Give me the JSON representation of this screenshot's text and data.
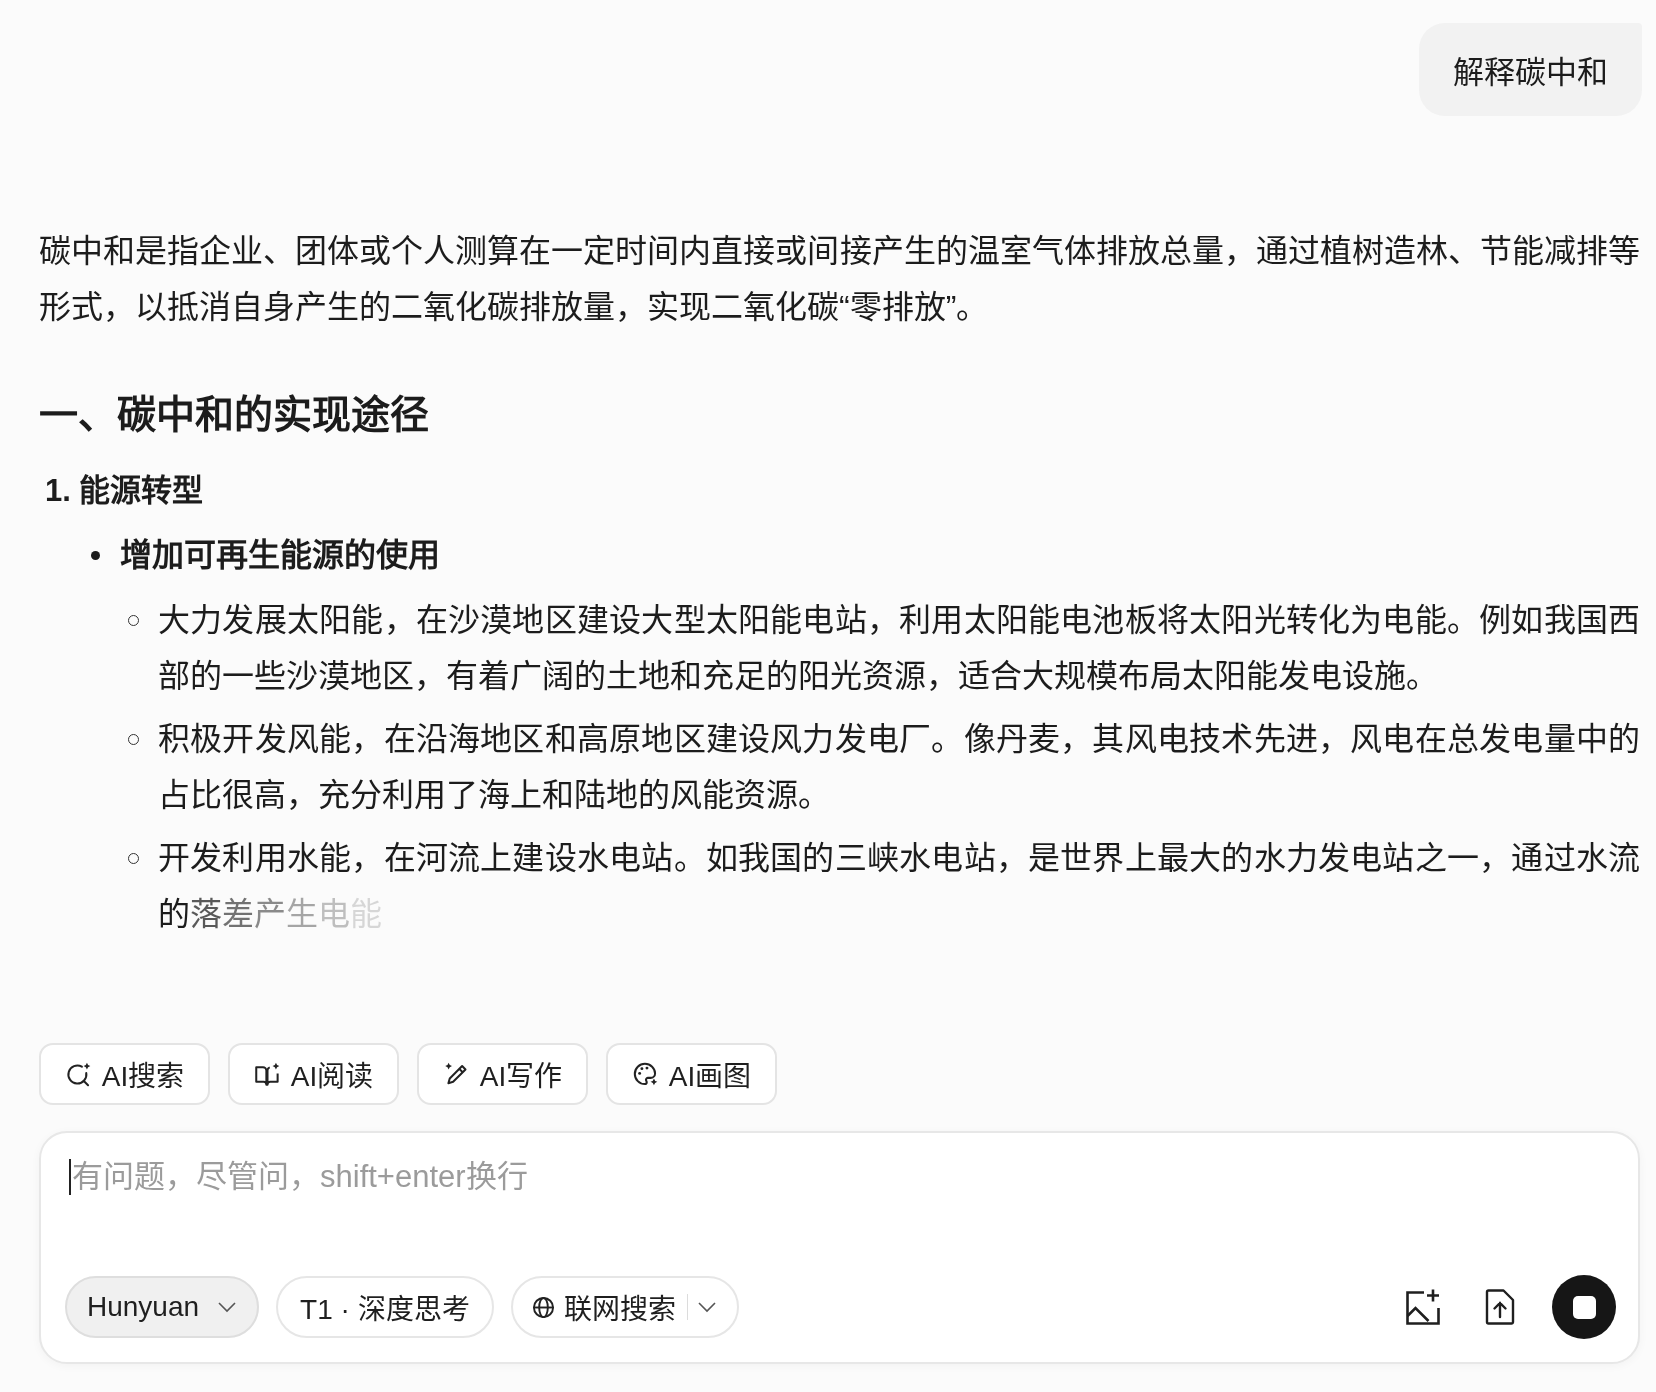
{
  "user_message": {
    "text": "解释碳中和"
  },
  "answer": {
    "intro": "碳中和是指企业、团体或个人测算在一定时间内直接或间接产生的温室气体排放总量，通过植树造林、节能减排等形式，以抵消自身产生的二氧化碳排放量，实现二氧化碳“零排放”。",
    "sections": [
      {
        "heading": "一、碳中和的实现途径",
        "items": [
          {
            "number": "1.",
            "title": "能源转型",
            "children": [
              {
                "text": "增加可再生能源的使用",
                "children": [
                  {
                    "text": "大力发展太阳能，在沙漠地区建设大型太阳能电站，利用太阳能电池板将太阳光转化为电能。例如我国西部的一些沙漠地区，有着广阔的土地和充足的阳光资源，适合大规模布局太阳能发电设施。"
                  },
                  {
                    "text": "积极开发风能，在沿海地区和高原地区建设风力发电厂。像丹麦，其风电技术先进，风电在总发电量中的占比很高，充分利用了海上和陆地的风能资源。"
                  },
                  {
                    "text": "开发利用水能，在河流上建设水电站。如我国的三峡水电站，是世界上最大的水力发电站之一，通过水流的",
                    "fading_tail": "落差产生电能"
                  }
                ]
              }
            ]
          }
        ]
      }
    ]
  },
  "quick_actions": [
    {
      "kind": "search",
      "label": "AI搜索"
    },
    {
      "kind": "read",
      "label": "AI阅读"
    },
    {
      "kind": "write",
      "label": "AI写作"
    },
    {
      "kind": "draw",
      "label": "AI画图"
    }
  ],
  "composer": {
    "placeholder": "有问题，尽管问，shift+enter换行",
    "focused": true,
    "options": [
      {
        "kind": "model",
        "label": "Hunyuan"
      },
      {
        "kind": "toggle",
        "label": "T1 · 深度思考",
        "on": false
      },
      {
        "kind": "search-toggle",
        "label": "联网搜索",
        "on": false
      }
    ],
    "generating": true
  }
}
